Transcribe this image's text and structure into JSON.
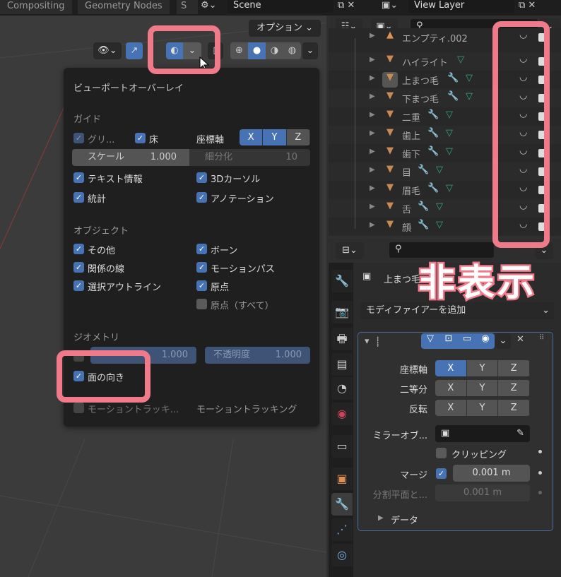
{
  "topbar": {
    "tabs": [
      "Compositing",
      "Geometry Nodes",
      "S"
    ],
    "scene": "Scene",
    "view_layer": "View Layer"
  },
  "viewport": {
    "options_label": "オプション ⌄"
  },
  "overlay": {
    "title": "ビューポートオーバーレイ",
    "guide": {
      "heading": "ガイド",
      "grid": "グリ...",
      "floor": "床",
      "axes_label": "座標軸",
      "axes": [
        "X",
        "Y",
        "Z"
      ],
      "scale_label": "スケール",
      "scale_value": "1.000",
      "subdiv_label": "細分化",
      "subdiv_value": "10",
      "text_info": "テキスト情報",
      "cursor3d": "3Dカーソル",
      "stats": "統計",
      "annotation": "アノテーション"
    },
    "object": {
      "heading": "オブジェクト",
      "extras": "その他",
      "bones": "ボーン",
      "relations": "関係の線",
      "motion_paths": "モーションパス",
      "outline": "選択アウトライン",
      "origins": "原点",
      "origins_all": "原点（すべて）"
    },
    "geometry": {
      "heading": "ジオメトリ",
      "wire_value": "1.000",
      "opacity_label": "不透明度",
      "opacity_value": "1.000",
      "face_orientation": "面の向き"
    },
    "motion_tracking": {
      "label": "モーショントラッキ...",
      "label2": "モーショントラッキング"
    }
  },
  "outliner": {
    "rows": [
      {
        "name": "エンプティ.002",
        "modifier": false,
        "mesh": false
      },
      {
        "name": "ハイライト",
        "modifier": false,
        "mesh": true
      },
      {
        "name": "上まつ毛",
        "modifier": true,
        "mesh": true,
        "active": true
      },
      {
        "name": "下まつ毛",
        "modifier": true,
        "mesh": true
      },
      {
        "name": "二重",
        "modifier": true,
        "mesh": true
      },
      {
        "name": "歯上",
        "modifier": true,
        "mesh": true
      },
      {
        "name": "歯下",
        "modifier": true,
        "mesh": true
      },
      {
        "name": "目",
        "modifier": true,
        "mesh": true
      },
      {
        "name": "眉毛",
        "modifier": true,
        "mesh": true
      },
      {
        "name": "舌",
        "modifier": true,
        "mesh": true
      },
      {
        "name": "顔",
        "modifier": true,
        "mesh": true
      }
    ]
  },
  "properties": {
    "object_name": "上まつ毛",
    "add_modifier": "モディファイアーを追加",
    "axis_label": "座標軸",
    "bisect_label": "二等分",
    "flip_label": "反転",
    "xyz": [
      "X",
      "Y",
      "Z"
    ],
    "mirror_object_label": "ミラーオブ...",
    "clipping_label": "クリッピング",
    "merge_label": "マージ",
    "merge_value": "0.001 m",
    "bisect_dist_label": "分割平面と...",
    "bisect_dist_value": "0.001 m",
    "data_label": "データ"
  },
  "annotation": {
    "text": "非表示",
    "color": "#f07a8a"
  }
}
